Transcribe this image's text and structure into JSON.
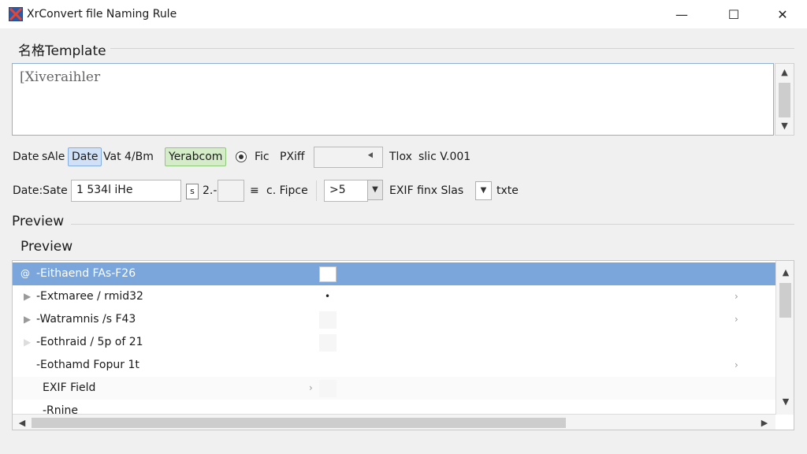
{
  "window": {
    "title": "XrConvert file Naming Rule",
    "minimize_glyph": "—",
    "maximize_glyph": "☐",
    "close_glyph": "✕"
  },
  "template": {
    "label": "名格Template",
    "value": "[Xiveraihler"
  },
  "row1": {
    "date_label": "Date",
    "sale_label": "sAle",
    "date_chip": "Date",
    "vat_text": "Vat 4/Bm",
    "year_chip": "Yerabcom",
    "fic_label": "Fic",
    "pxif_label": "PXiff",
    "pxif_value": "",
    "tlox_label": "Tlox",
    "slic_label": "slic V.001"
  },
  "row2": {
    "date_sate_label": "Date:Sate",
    "date_value": "1   534l    iHe",
    "stepper_value": "2.-0",
    "fipce_label": "c. Fipce",
    "select_value": ">5",
    "exif_label": "EXIF finx Slas",
    "txte_label": "txte"
  },
  "preview": {
    "outer_label": "Preview",
    "inner_label": "Preview",
    "rows": [
      {
        "text": "-Eithaend FAs-F26",
        "selected": true
      },
      {
        "text": "-Extmaree / rmid32",
        "selected": false
      },
      {
        "text": "-Watramnis /s F43",
        "selected": false
      },
      {
        "text": "-Eothraid / 5p of 21",
        "selected": false
      },
      {
        "text": "-Eothamd Fopur 1t",
        "selected": false
      },
      {
        "text": "EXIF Field",
        "selected": false
      },
      {
        "text": "-Rnine",
        "selected": false
      }
    ]
  },
  "colors": {
    "selection": "#7aa6dc",
    "date_chip_bg": "#cfe0f7",
    "year_chip_bg": "#d4ecc8"
  }
}
